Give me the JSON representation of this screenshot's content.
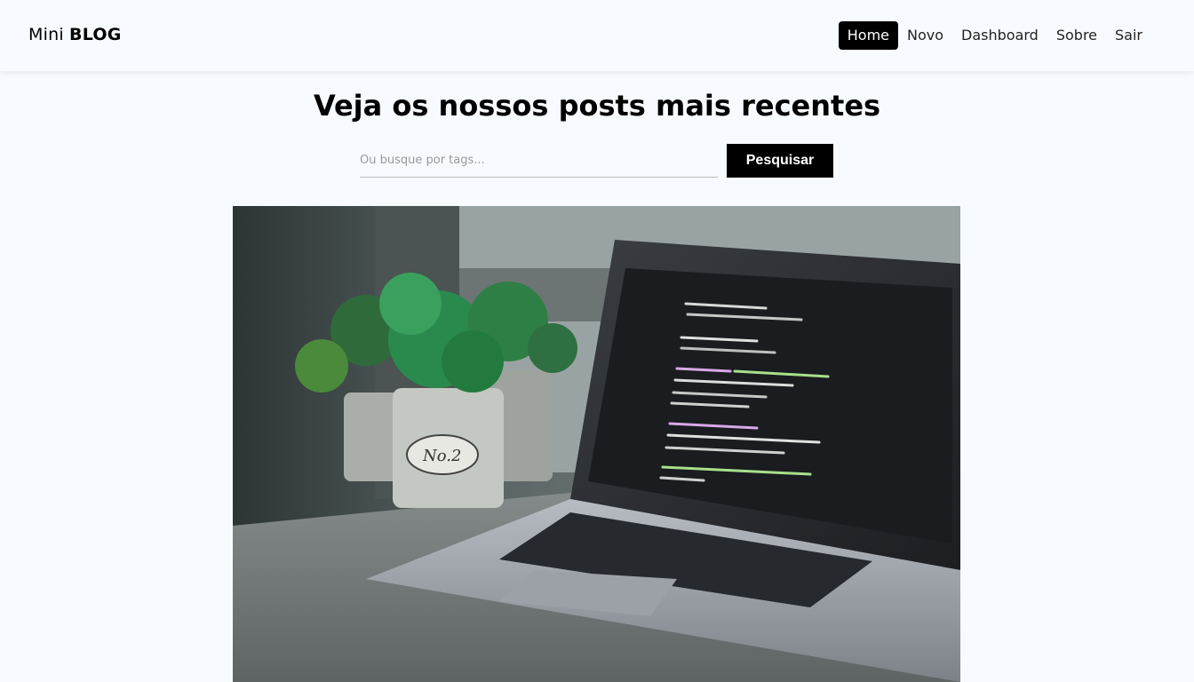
{
  "brand": {
    "light": "Mini ",
    "bold": "BLOG"
  },
  "nav": {
    "items": [
      {
        "label": "Home",
        "active": true
      },
      {
        "label": "Novo",
        "active": false
      },
      {
        "label": "Dashboard",
        "active": false
      },
      {
        "label": "Sobre",
        "active": false
      },
      {
        "label": "Sair",
        "active": false
      }
    ]
  },
  "main": {
    "title": "Veja os nossos posts mais recentes",
    "search": {
      "placeholder": "Ou busque por tags...",
      "value": "",
      "button_label": "Pesquisar"
    },
    "post": {
      "image_description": "photo-laptop-plants"
    }
  },
  "colors": {
    "background": "#f7fbff",
    "accent": "#000000",
    "button_text": "#ffffff"
  }
}
